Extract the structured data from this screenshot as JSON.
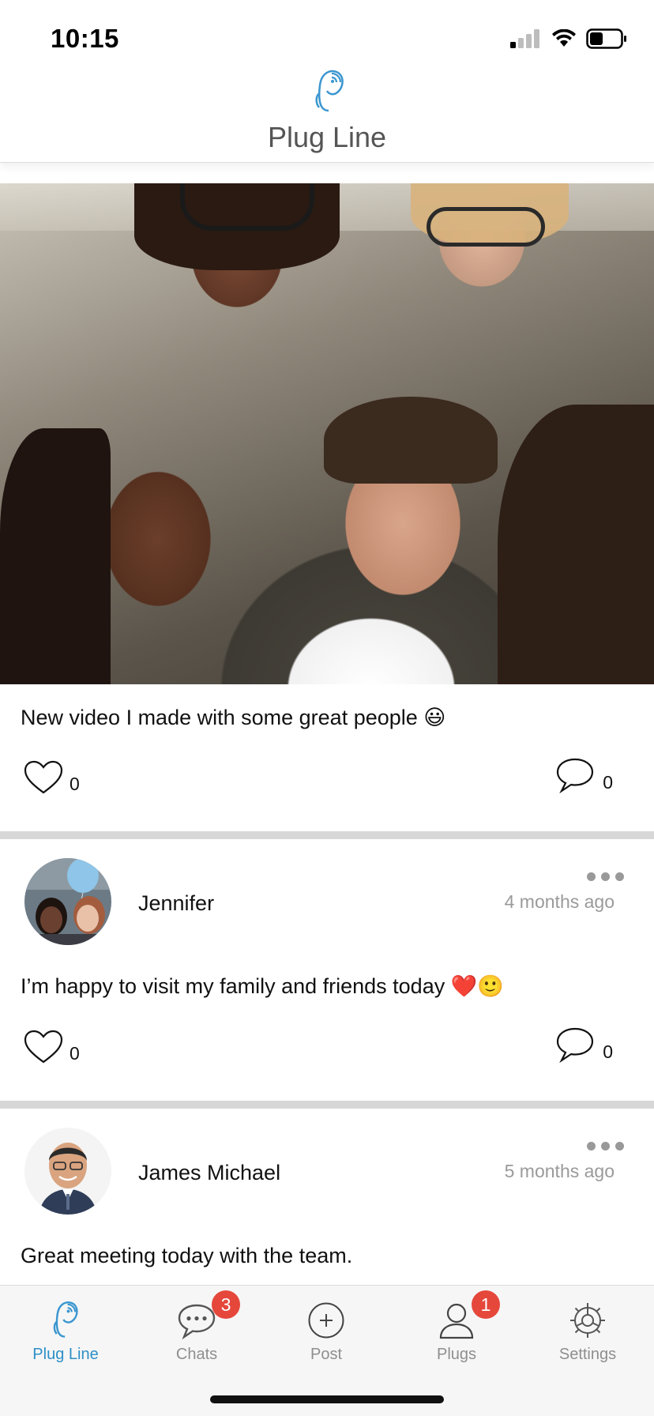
{
  "status_bar": {
    "time": "10:15"
  },
  "header": {
    "title": "Plug Line",
    "accent_color": "#2e8fc6"
  },
  "feed": {
    "posts": [
      {
        "image": "group-selfie-photo",
        "text": "New video I made with some great people 😃",
        "likes": "0",
        "comments": "0"
      },
      {
        "author": "Jennifer",
        "time_ago": "4 months ago",
        "text": "I’m happy to visit my family and friends today ❤️🙂",
        "likes": "0",
        "comments": "0"
      },
      {
        "author": "James Michael",
        "time_ago": "5 months ago",
        "text": "Great meeting today with the team."
      }
    ]
  },
  "tab_bar": {
    "tabs": [
      {
        "label": "Plug Line",
        "icon": "plugline-logo-icon",
        "active": true
      },
      {
        "label": "Chats",
        "icon": "chat-bubble-icon",
        "badge": "3"
      },
      {
        "label": "Post",
        "icon": "plus-circle-icon"
      },
      {
        "label": "Plugs",
        "icon": "person-icon",
        "badge": "1"
      },
      {
        "label": "Settings",
        "icon": "gear-icon"
      }
    ],
    "badge_color": "#e5473b"
  }
}
